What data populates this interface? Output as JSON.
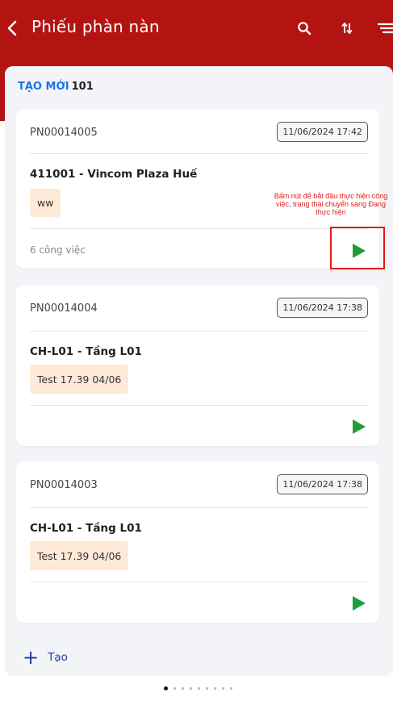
{
  "app": {
    "title": "Phiếu phàn nàn"
  },
  "section": {
    "status": "TẠO MỚI",
    "count": "101"
  },
  "tickets": [
    {
      "code": "PN00014005",
      "date": "11/06/2024  17:42",
      "location": "411001 - Vincom Plaza Huế",
      "tag": "ww",
      "tasks": "6 công việc"
    },
    {
      "code": "PN00014004",
      "date": "11/06/2024  17:38",
      "location": "CH-L01 - Tầng L01",
      "tag": "Test 17.39 04/06",
      "tasks": ""
    },
    {
      "code": "PN00014003",
      "date": "11/06/2024  17:38",
      "location": "CH-L01 - Tầng L01",
      "tag": "Test 17.39 04/06",
      "tasks": ""
    }
  ],
  "annotation": {
    "text": "Bấm nút để bắt đầu thực hiện công việc, trạng thái chuyển sang Đang thực hiện"
  },
  "create": {
    "label": "Tạo"
  },
  "pager": {
    "total": 9,
    "active": 1
  },
  "colors": {
    "header": "#b31412",
    "play": "#1f9d3a",
    "accent": "#1a73e8",
    "annotation": "#e21b1b"
  },
  "icons": [
    "back-icon",
    "search-icon",
    "sort-icon",
    "filter-icon",
    "play-icon",
    "plus-icon"
  ]
}
